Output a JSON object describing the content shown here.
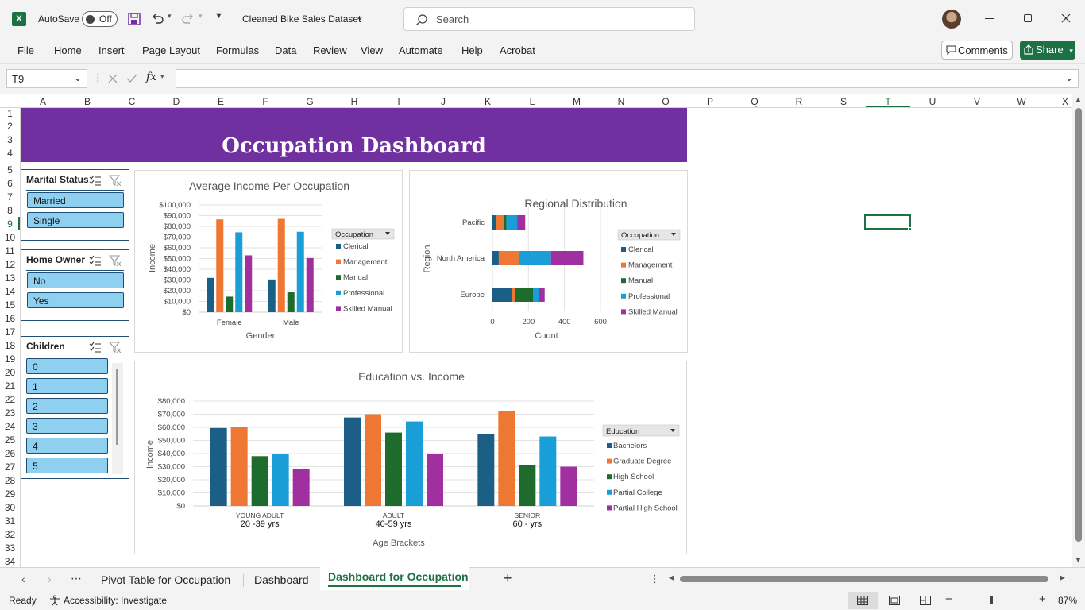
{
  "titlebar": {
    "autosave_label": "AutoSave",
    "autosave_state": "Off",
    "filename": "Cleaned Bike Sales Dataset",
    "search_placeholder": "Search"
  },
  "ribbon": {
    "tabs": [
      "File",
      "Home",
      "Insert",
      "Page Layout",
      "Formulas",
      "Data",
      "Review",
      "View",
      "Automate",
      "Help",
      "Acrobat"
    ],
    "comments_label": "Comments",
    "share_label": "Share"
  },
  "formula_bar": {
    "name_box": "T9",
    "fx_label": "fx",
    "formula": ""
  },
  "grid": {
    "columns": [
      "A",
      "B",
      "C",
      "D",
      "E",
      "F",
      "G",
      "H",
      "I",
      "J",
      "K",
      "L",
      "M",
      "N",
      "O",
      "P",
      "Q",
      "R",
      "S",
      "T",
      "U",
      "V",
      "W",
      "X"
    ],
    "rows": [
      "1",
      "2",
      "3",
      "4",
      "5",
      "6",
      "7",
      "8",
      "9",
      "10",
      "11",
      "12",
      "13",
      "14",
      "15",
      "16",
      "17",
      "18",
      "19",
      "20",
      "21",
      "22",
      "23",
      "24",
      "25",
      "26",
      "27",
      "28",
      "29",
      "30",
      "31",
      "32",
      "33",
      "34"
    ],
    "selected_column": "T",
    "selected_row": "9"
  },
  "dashboard": {
    "title": "Occupation Dashboard",
    "banner_color": "#7030a0"
  },
  "slicers": {
    "marital": {
      "title": "Marital Status",
      "items": [
        "Married",
        "Single"
      ]
    },
    "homeowner": {
      "title": "Home Owner",
      "items": [
        "No",
        "Yes"
      ]
    },
    "children": {
      "title": "Children",
      "items": [
        "0",
        "1",
        "2",
        "3",
        "4",
        "5"
      ]
    }
  },
  "colors": {
    "Clerical": "#1b5e86",
    "Management": "#ee7733",
    "Manual": "#1e6b2e",
    "Professional": "#1a9ed8",
    "Skilled Manual": "#a0309f"
  },
  "chart_data": [
    {
      "type": "bar",
      "title": "Average Income Per Occupation",
      "xlabel": "Gender",
      "ylabel": "Income",
      "legend_title": "Occupation",
      "legend_position": "right",
      "categories": [
        "Female",
        "Male"
      ],
      "yticks": [
        "$0",
        "$10,000",
        "$20,000",
        "$30,000",
        "$40,000",
        "$50,000",
        "$60,000",
        "$70,000",
        "$80,000",
        "$90,000",
        "$100,000"
      ],
      "ylim": [
        0,
        100000
      ],
      "series": [
        {
          "name": "Clerical",
          "values": [
            32000,
            30500
          ]
        },
        {
          "name": "Management",
          "values": [
            86500,
            87000
          ]
        },
        {
          "name": "Manual",
          "values": [
            14500,
            18500
          ]
        },
        {
          "name": "Professional",
          "values": [
            74500,
            75000
          ]
        },
        {
          "name": "Skilled Manual",
          "values": [
            53000,
            50500
          ]
        }
      ]
    },
    {
      "type": "bar",
      "orientation": "horizontal-stacked",
      "title": "Regional Distribution",
      "xlabel": "Count",
      "ylabel": "Region",
      "legend_title": "Occupation",
      "legend_position": "right",
      "categories": [
        "Pacific",
        "North America",
        "Europe"
      ],
      "xticks": [
        "0",
        "200",
        "400",
        "600"
      ],
      "xlim": [
        0,
        600
      ],
      "series": [
        {
          "name": "Clerical",
          "values": [
            20,
            35,
            110
          ]
        },
        {
          "name": "Management",
          "values": [
            45,
            110,
            15
          ]
        },
        {
          "name": "Manual",
          "values": [
            12,
            5,
            100
          ]
        },
        {
          "name": "Professional",
          "values": [
            60,
            175,
            35
          ]
        },
        {
          "name": "Skilled Manual",
          "values": [
            45,
            180,
            30
          ]
        }
      ]
    },
    {
      "type": "bar",
      "title": "Education vs. Income",
      "xlabel": "Age Brackets",
      "ylabel": "Income",
      "legend_title": "Education",
      "legend_position": "right",
      "categories": [
        "YOUNG ADULT",
        "ADULT",
        "SENIOR"
      ],
      "category_sublabels": [
        "20 -39 yrs",
        "40-59 yrs",
        "60 - yrs"
      ],
      "yticks": [
        "$0",
        "$10,000",
        "$20,000",
        "$30,000",
        "$40,000",
        "$50,000",
        "$60,000",
        "$70,000",
        "$80,000"
      ],
      "ylim": [
        0,
        80000
      ],
      "series": [
        {
          "name": "Bachelors",
          "values": [
            59500,
            67500,
            55000
          ]
        },
        {
          "name": "Graduate Degree",
          "values": [
            60000,
            70000,
            72500
          ]
        },
        {
          "name": "High School",
          "values": [
            38000,
            56000,
            31000
          ]
        },
        {
          "name": "Partial College",
          "values": [
            39500,
            64500,
            53000
          ]
        },
        {
          "name": "Partial High School",
          "values": [
            28500,
            39500,
            30000
          ]
        }
      ]
    }
  ],
  "sheets": {
    "tabs": [
      "Pivot Table for Occupation",
      "Dashboard",
      "Dashboard for Occupation"
    ],
    "active": "Dashboard for Occupation"
  },
  "status": {
    "ready": "Ready",
    "accessibility": "Accessibility: Investigate",
    "zoom": "87%"
  }
}
